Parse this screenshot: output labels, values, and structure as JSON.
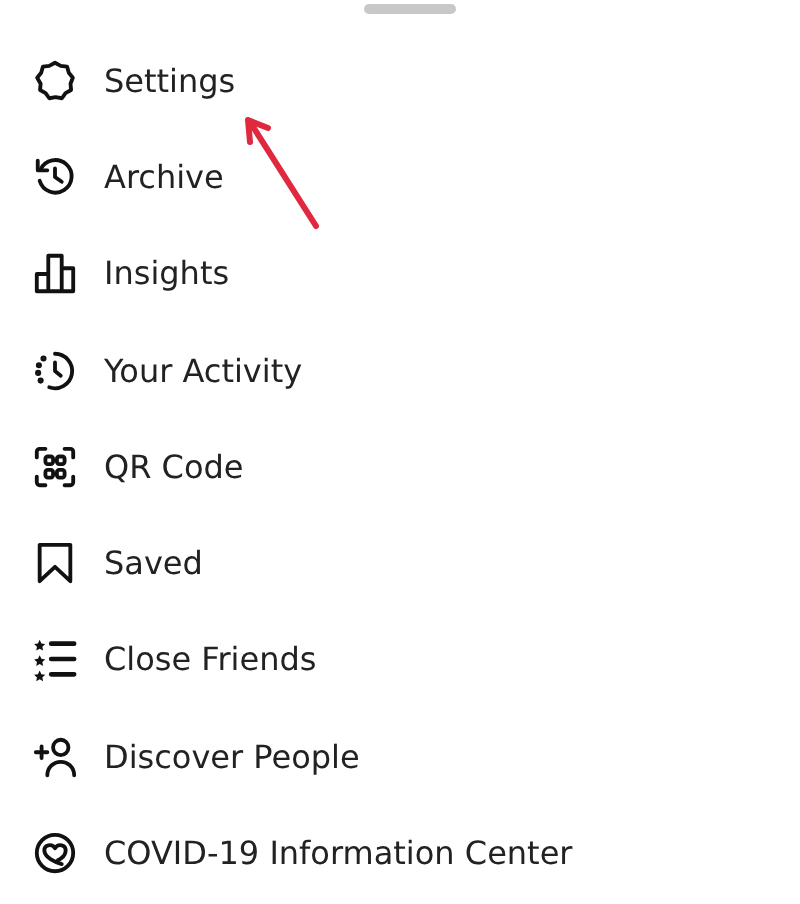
{
  "menu": {
    "items": [
      {
        "kind": "settings",
        "label": "Settings"
      },
      {
        "kind": "archive",
        "label": "Archive"
      },
      {
        "kind": "insights",
        "label": "Insights"
      },
      {
        "kind": "activity",
        "label": "Your Activity"
      },
      {
        "kind": "qr",
        "label": "QR Code"
      },
      {
        "kind": "saved",
        "label": "Saved"
      },
      {
        "kind": "close_friends",
        "label": "Close Friends"
      },
      {
        "kind": "discover",
        "label": "Discover People"
      },
      {
        "kind": "covid",
        "label": "COVID-19 Information Center"
      }
    ]
  }
}
